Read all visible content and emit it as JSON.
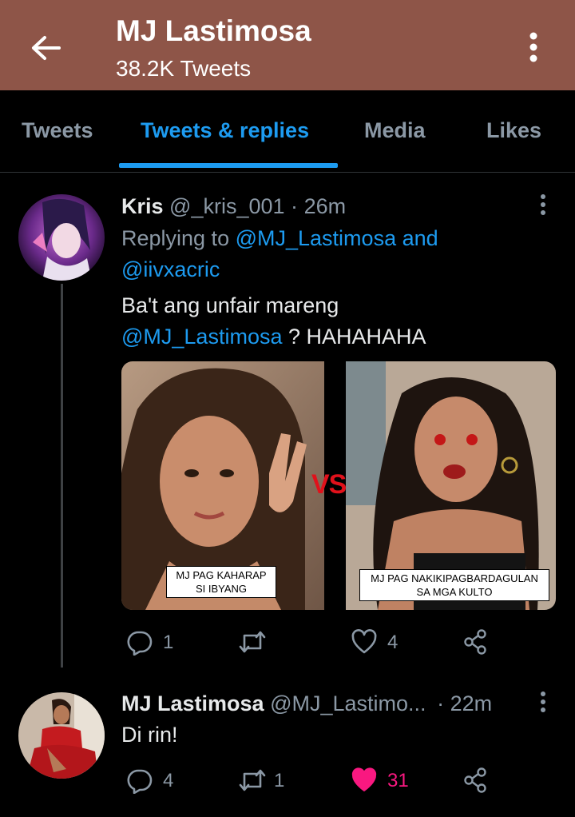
{
  "header": {
    "title": "MJ Lastimosa",
    "subtitle": "38.2K Tweets"
  },
  "tabs": [
    {
      "label": "Tweets"
    },
    {
      "label": "Tweets & replies"
    },
    {
      "label": "Media"
    },
    {
      "label": "Likes"
    }
  ],
  "tweets": [
    {
      "name": "Kris",
      "handle": "@_kris_001",
      "sep": "·",
      "time": "26m",
      "replying_prefix": "Replying to",
      "replying_user1": "@MJ_Lastimosa",
      "replying_and": "and",
      "replying_user2": "@iivxacric",
      "text_line1": "Ba't ang unfair mareng",
      "text_mention": "@MJ_Lastimosa",
      "text_rest": "? HAHAHAHA",
      "media": {
        "left_caption_line1": "MJ PAG KAHARAP",
        "left_caption_line2": "SI IBYANG",
        "vs_label": "VS",
        "right_caption_line1": "MJ PAG NAKIKIPAGBARDAGULAN",
        "right_caption_line2": "SA MGA KULTO"
      },
      "replies": "1",
      "retweets": "",
      "likes": "4"
    },
    {
      "name": "MJ Lastimosa",
      "handle": "@MJ_Lastimo...",
      "sep": "·",
      "time": "22m",
      "text": "Di rin!",
      "replies": "4",
      "retweets": "1",
      "likes": "31"
    }
  ],
  "colors": {
    "header_bg": "#8e5548",
    "accent": "#1d9bf0",
    "like": "#f91880",
    "muted": "#8b98a5"
  },
  "icons": [
    "back-arrow-icon",
    "more-vertical-icon",
    "reply-icon",
    "retweet-icon",
    "heart-icon",
    "share-icon"
  ]
}
